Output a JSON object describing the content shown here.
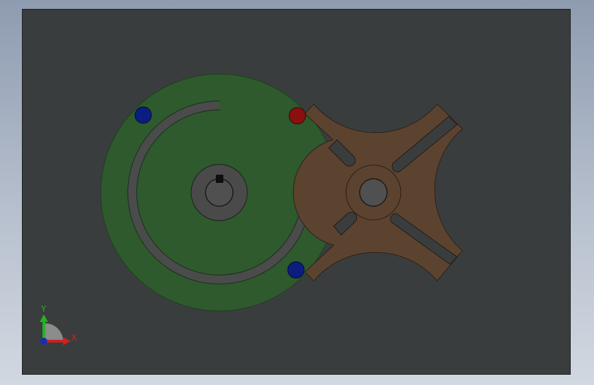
{
  "triad": {
    "x_label": "X",
    "y_label": "Y",
    "x_color": "#d11f1f",
    "y_color": "#21b521",
    "z_color": "#1a2bb8"
  },
  "colors": {
    "background_top": "#8e9bb0",
    "background_bottom": "#d2d8e1",
    "viewport_fill": "#3a3d3e",
    "drive_wheel": "#2e5a2d",
    "geneva_wheel": "#5b4330",
    "hub": "#4a4a4a",
    "bore": "#505050",
    "red_pin": "#8a1010",
    "blue_pin": "#0c1d80"
  },
  "model": {
    "drive_wheel": "drive-wheel",
    "geneva_wheel": "geneva-wheel",
    "pins": [
      "red-pin",
      "blue-pin-top",
      "blue-pin-bottom"
    ]
  }
}
